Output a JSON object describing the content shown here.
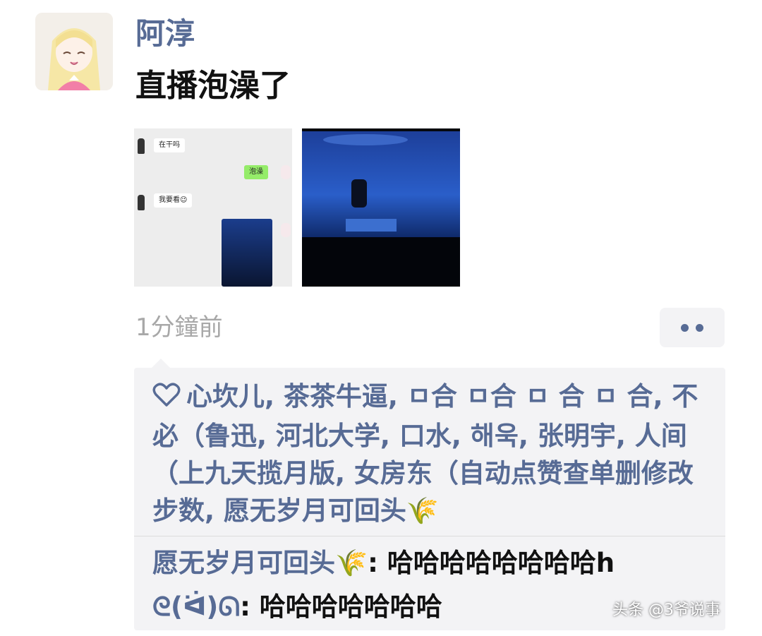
{
  "post": {
    "author": "阿淳",
    "text": "直播泡澡了",
    "time": "1分鐘前"
  },
  "screenshot_chat": {
    "msg1": "在干吗",
    "msg2": "泡澡",
    "msg3": "我要看😉"
  },
  "likes": {
    "text": "心坎儿, 茶茶牛逼, ㅁ合 ㅁ合  ㅁ 合  ㅁ 合, 不必（鲁迅, 河北大学, 口水, 해욱, 张明宇, 人间（上九天揽月版, 女房东（自动点赞查单删修改步数, 愿无岁月可回头🌾"
  },
  "comments": [
    {
      "name": "愿无岁月可回头🌾",
      "text": ": 哈哈哈哈哈哈哈哈h"
    },
    {
      "name": "ᘓ(ᐛ)ᘏ",
      "text": ": 哈哈哈哈哈哈哈"
    }
  ],
  "watermark": "头条 @3爷说事",
  "colors": {
    "link": "#576b95",
    "panel": "#f3f3f5",
    "time": "#a8a8a8"
  }
}
